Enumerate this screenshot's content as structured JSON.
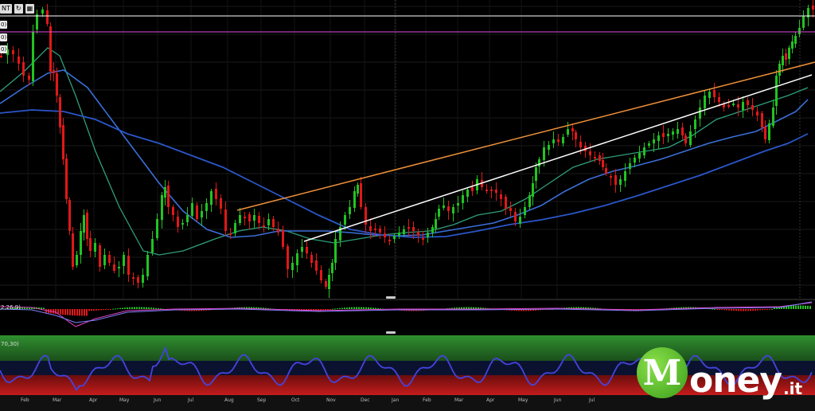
{
  "toolbar": {
    "partial_label": "NT",
    "refresh_icon": "refresh-icon",
    "calendar_icon": "calendar-icon"
  },
  "indicator_labels": {
    "line1": "0)",
    "line2": "0)",
    "line3": "0)",
    "macd": "2,26,9)",
    "rsi": "70,30)"
  },
  "months": [
    "Feb",
    "Mar",
    "Apr",
    "May",
    "Jun",
    "Jul",
    "Aug",
    "Sep",
    "Oct",
    "Nov",
    "Dec",
    "Jan",
    "Feb",
    "Mar",
    "Apr",
    "May",
    "Jun",
    "Jul"
  ],
  "logo": {
    "letter": "M",
    "rest": "oney",
    "domain": ".it"
  },
  "colors": {
    "bull": "#22c322",
    "bear": "#e01818",
    "ma_fast": "#2f9e7a",
    "ma_mid": "#3a6fd8",
    "ma_slow": "#2a56c8",
    "trend_orange": "#f0913a",
    "trend_white": "#ffffff",
    "hline_white": "#ffffff",
    "hline_magenta": "#e04be0",
    "rsi_line": "#4444dd",
    "macd_signal": "#e040c0"
  }
}
